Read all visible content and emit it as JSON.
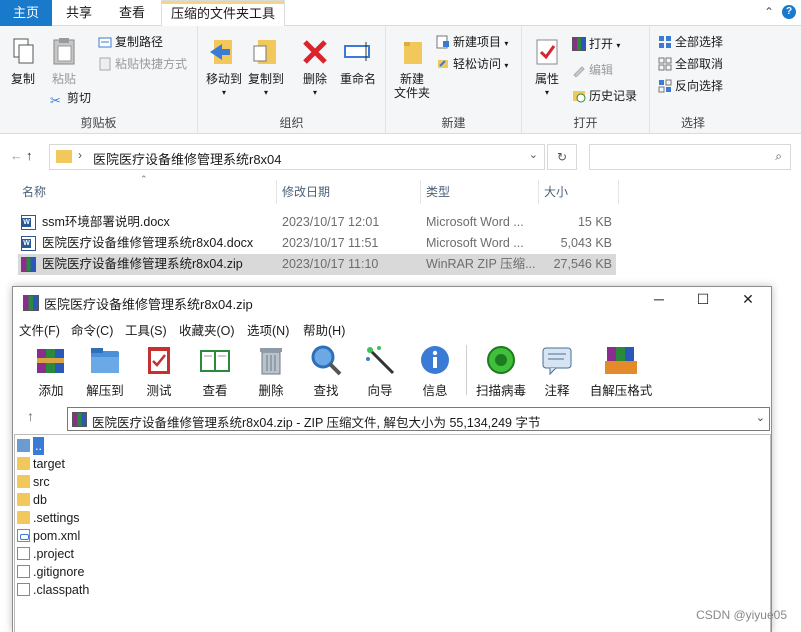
{
  "explorer": {
    "tabs": {
      "home": "主页",
      "share": "共享",
      "view": "查看",
      "tools": "压缩的文件夹工具"
    },
    "ribbon": {
      "clipboard": {
        "label": "剪贴板",
        "copy": "复制",
        "paste": "粘贴",
        "copy_path": "复制路径",
        "paste_shortcut": "粘贴快捷方式",
        "cut": "剪切"
      },
      "organize": {
        "label": "组织",
        "move_to": "移动到",
        "copy_to": "复制到",
        "delete": "删除",
        "rename": "重命名"
      },
      "new": {
        "label": "新建",
        "new_folder_line1": "新建",
        "new_folder_line2": "文件夹",
        "new_item": "新建项目",
        "easy_access": "轻松访问"
      },
      "open": {
        "label": "打开",
        "properties": "属性",
        "open": "打开",
        "edit": "编辑",
        "history": "历史记录"
      },
      "select": {
        "label": "选择",
        "select_all": "全部选择",
        "select_none": "全部取消",
        "invert": "反向选择"
      }
    },
    "address": {
      "path": "医院医疗设备维修管理系统r8x04",
      "search_placeholder": ""
    },
    "columns": {
      "name": "名称",
      "date": "修改日期",
      "type": "类型",
      "size": "大小"
    },
    "files": [
      {
        "name": "ssm环境部署说明.docx",
        "date": "2023/10/17 12:01",
        "type": "Microsoft Word ...",
        "size": "15 KB"
      },
      {
        "name": "医院医疗设备维修管理系统r8x04.docx",
        "date": "2023/10/17 11:51",
        "type": "Microsoft Word ...",
        "size": "5,043 KB"
      },
      {
        "name": "医院医疗设备维修管理系统r8x04.zip",
        "date": "2023/10/17 11:10",
        "type": "WinRAR ZIP 压缩...",
        "size": "27,546 KB"
      }
    ]
  },
  "winrar": {
    "title": "医院医疗设备维修管理系统r8x04.zip",
    "menu": [
      "文件(F)",
      "命令(C)",
      "工具(S)",
      "收藏夹(O)",
      "选项(N)",
      "帮助(H)"
    ],
    "toolbar": [
      "添加",
      "解压到",
      "测试",
      "查看",
      "删除",
      "查找",
      "向导",
      "信息",
      "扫描病毒",
      "注释",
      "自解压格式"
    ],
    "path_text": "医院医疗设备维修管理系统r8x04.zip - ZIP 压缩文件, 解包大小为 55,134,249 字节",
    "items": [
      "..",
      "target",
      "src",
      "db",
      ".settings",
      "pom.xml",
      ".project",
      ".gitignore",
      ".classpath"
    ]
  },
  "watermark": "CSDN @yiyue05",
  "colors": {
    "accent": "#1979ca",
    "selection": "#d9d9d9",
    "folder": "#f2c75c"
  }
}
